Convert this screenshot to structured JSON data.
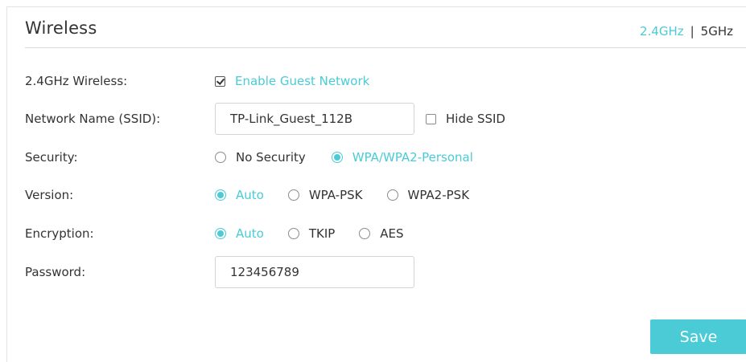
{
  "header": {
    "title": "Wireless",
    "bands": [
      "2.4GHz",
      "5GHz"
    ],
    "band_separator": "|",
    "active_band": "2.4GHz"
  },
  "wireless": {
    "label": "2.4GHz Wireless:",
    "enable_guest_label": "Enable Guest Network",
    "enabled": true
  },
  "ssid": {
    "label": "Network Name (SSID):",
    "value": "TP-Link_Guest_112B",
    "hide_label": "Hide SSID",
    "hidden": false
  },
  "security": {
    "label": "Security:",
    "options": [
      "No Security",
      "WPA/WPA2-Personal"
    ],
    "selected": "WPA/WPA2-Personal"
  },
  "version": {
    "label": "Version:",
    "options": [
      "Auto",
      "WPA-PSK",
      "WPA2-PSK"
    ],
    "selected": "Auto"
  },
  "encryption": {
    "label": "Encryption:",
    "options": [
      "Auto",
      "TKIP",
      "AES"
    ],
    "selected": "Auto"
  },
  "password": {
    "label": "Password:",
    "value": "123456789"
  },
  "actions": {
    "save_label": "Save"
  },
  "colors": {
    "accent": "#4acbd6",
    "text": "#333333",
    "border": "#d4d4d4"
  }
}
